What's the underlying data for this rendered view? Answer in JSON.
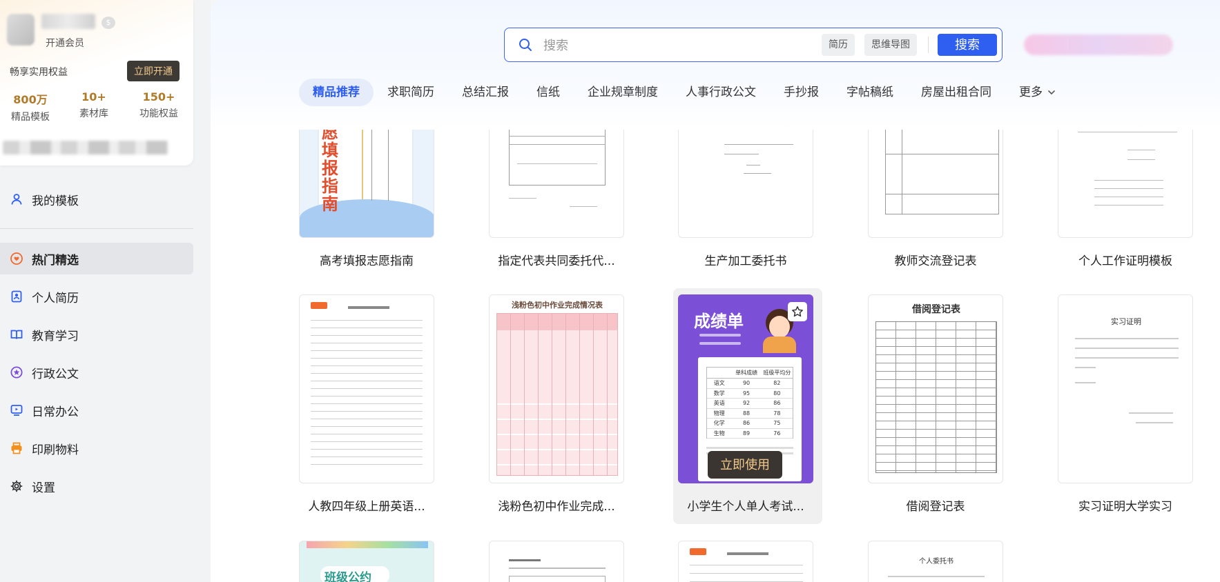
{
  "sidebar": {
    "vip_link": "开通会员",
    "enjoy": "畅享实用权益",
    "open_button": "立即开通",
    "stats": [
      {
        "num": "800万",
        "label": "精品模板"
      },
      {
        "num": "10+",
        "label": "素材库"
      },
      {
        "num": "150+",
        "label": "功能权益"
      }
    ],
    "nav": [
      {
        "label": "我的模板",
        "icon": "user-icon"
      },
      {
        "label": "热门精选",
        "icon": "heart-icon"
      },
      {
        "label": "个人简历",
        "icon": "resume-icon"
      },
      {
        "label": "教育学习",
        "icon": "book-icon"
      },
      {
        "label": "行政公文",
        "icon": "badge-icon"
      },
      {
        "label": "日常办公",
        "icon": "monitor-icon"
      },
      {
        "label": "印刷物料",
        "icon": "printer-icon"
      },
      {
        "label": "设置",
        "icon": "gear-icon"
      }
    ]
  },
  "search": {
    "placeholder": "搜索",
    "chips": [
      "简历",
      "思维导图"
    ],
    "button": "搜索"
  },
  "tabs": [
    "精品推荐",
    "求职简历",
    "总结汇报",
    "信纸",
    "企业规章制度",
    "人事行政公文",
    "手抄报",
    "字帖稿纸",
    "房屋出租合同"
  ],
  "more_label": "更多",
  "templates": {
    "row1": [
      "高考填报志愿指南",
      "指定代表共同委托代...",
      "生产加工委托书",
      "教师交流登记表",
      "个人工作证明模板"
    ],
    "row2": [
      "人教四年级上册英语...",
      "浅粉色初中作业完成...",
      "小学生个人单人考试...",
      "借阅登记表",
      "实习证明大学实习"
    ]
  },
  "thumb_text": {
    "gaokao": "愿填报指南",
    "pink_title": "浅粉色初中作业完成情况表",
    "score_title": "成绩单",
    "score_rows": [
      [
        "语文",
        "90",
        "82"
      ],
      [
        "数学",
        "95",
        "80"
      ],
      [
        "英语",
        "92",
        "86"
      ],
      [
        "物理",
        "88",
        "78"
      ],
      [
        "化学",
        "86",
        "75"
      ],
      [
        "生物",
        "89",
        "76"
      ]
    ],
    "score_head": [
      "单科成绩",
      "班级平均分"
    ],
    "borrow_title": "借阅登记表",
    "intern_title": "实习证明",
    "class_title": "班级公约",
    "entrust_title": "个人委托书"
  },
  "use_button": "立即使用",
  "colors": {
    "accent": "#2f5ff0",
    "vip_gold": "#b07a28",
    "score_purple": "#7b4fd6"
  }
}
